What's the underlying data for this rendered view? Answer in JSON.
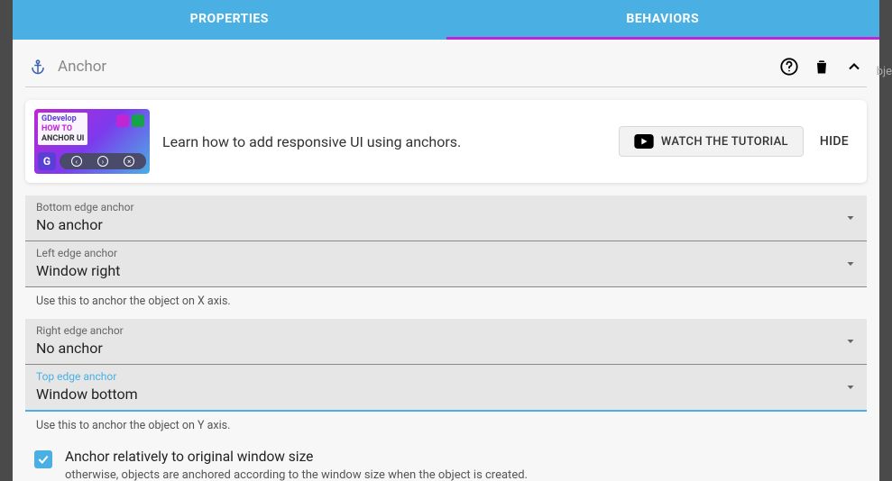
{
  "tabs": {
    "properties": "PROPERTIES",
    "behaviors": "BEHAVIORS"
  },
  "header": {
    "title": "Anchor"
  },
  "tutorial": {
    "thumb": {
      "brand": "GDevelop",
      "line1": "HOW TO",
      "line2": "ANCHOR UI"
    },
    "text": "Learn how to add responsive UI using anchors.",
    "watch": "WATCH THE TUTORIAL",
    "hide": "HIDE"
  },
  "fields": {
    "bottom": {
      "label": "Bottom edge anchor",
      "value": "No anchor"
    },
    "left": {
      "label": "Left edge anchor",
      "value": "Window right"
    },
    "left_help": "Use this to anchor the object on X axis.",
    "right": {
      "label": "Right edge anchor",
      "value": "No anchor"
    },
    "top": {
      "label": "Top edge anchor",
      "value": "Window bottom"
    },
    "top_help": "Use this to anchor the object on Y axis."
  },
  "checkbox": {
    "title": "Anchor relatively to original window size",
    "sub": "otherwise, objects are anchored according to the window size when the object is created."
  },
  "side_text": "bje"
}
